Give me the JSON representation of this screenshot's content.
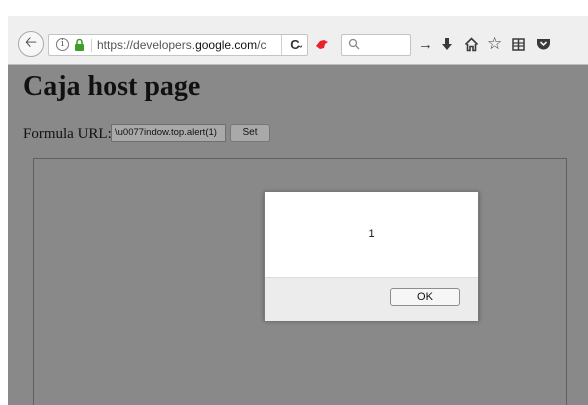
{
  "browser": {
    "url_prefix": "https://developers.",
    "url_domain": "google.com",
    "url_suffix": "/c",
    "search_placeholder_icon": "search-icon",
    "toolbar_icons": [
      "arrow-right-icon",
      "download-icon",
      "home-icon",
      "star-icon",
      "reading-list-icon",
      "pocket-icon"
    ]
  },
  "page": {
    "title": "Caja host page",
    "formula_label": "Formula URL:",
    "formula_value": "\\u0077indow.top.alert(1)",
    "set_label": "Set"
  },
  "dialog": {
    "message": "1",
    "ok_label": "OK"
  },
  "colors": {
    "page_background": "#898989",
    "dialog_background": "#ffffff",
    "bird_icon": "#e8232a"
  }
}
